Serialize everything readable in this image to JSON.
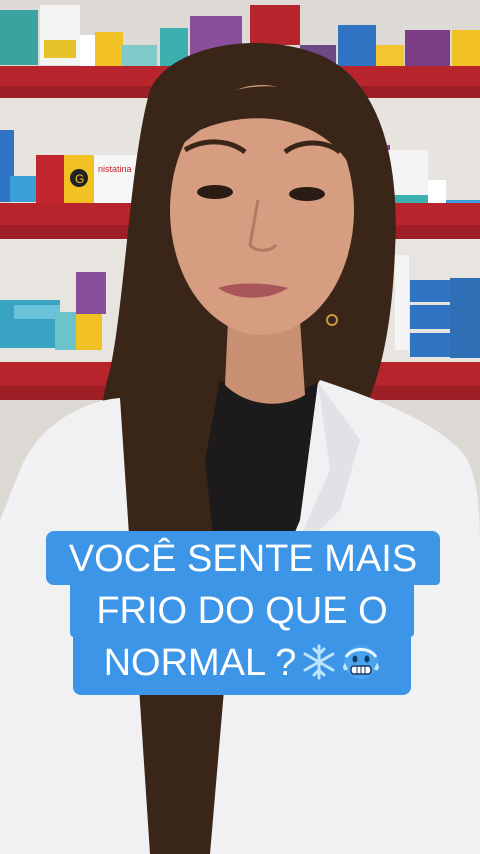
{
  "caption": {
    "line1": "VOCÊ SENTE MAIS",
    "line2": "FRIO DO QUE O",
    "line3": "NORMAL ?",
    "emoji_1": "snowflake-icon",
    "emoji_2": "cold-face-icon"
  },
  "shelf_labels": {
    "box_a": "G",
    "box_b": "nistatina"
  },
  "colors": {
    "caption_bg": "#3d95e8",
    "caption_text": "#ffffff",
    "shelf_red": "#b8242b",
    "coat": "#f1f1f3",
    "hair": "#3a2519"
  }
}
